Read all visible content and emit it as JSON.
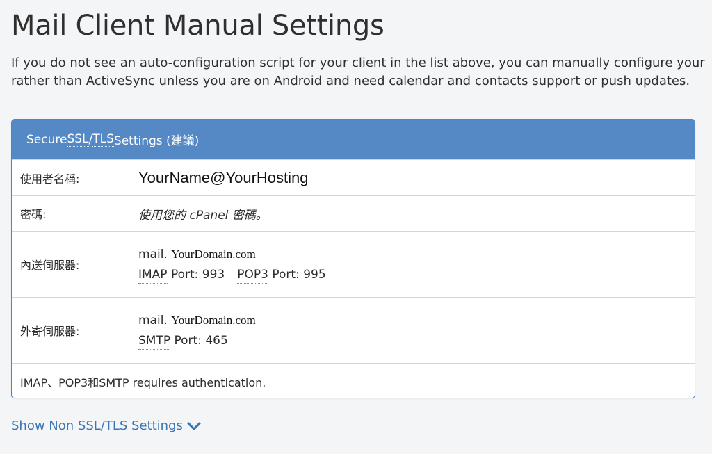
{
  "page": {
    "title": "Mail Client Manual Settings",
    "intro_line1": "If you do not see an auto-configuration script for your client in the list above, you can manually configure your",
    "intro_line2": "rather than ActiveSync unless you are on Android and need calendar and contacts support or push updates."
  },
  "panel": {
    "header_prefix": "Secure ",
    "header_ssl": "SSL",
    "header_slash": "/",
    "header_tls": "TLS",
    "header_suffix": " Settings (建議)",
    "username": {
      "label": "使用者名稱:",
      "value": "YourName@YourHosting"
    },
    "password": {
      "label": "密碼:",
      "value": "使用您的 cPanel 密碼。"
    },
    "incoming": {
      "label": "內送伺服器:",
      "host_prefix": "mail.",
      "host_domain": "YourDomain.com",
      "imap_label": "IMAP",
      "imap_port": " Port: 993",
      "pop3_label": "POP3",
      "pop3_port": " Port: 995"
    },
    "outgoing": {
      "label": "外寄伺服器:",
      "host_prefix": "mail.",
      "host_domain": "YourDomain.com",
      "smtp_label": "SMTP",
      "smtp_port": " Port: 465"
    },
    "note": "IMAP、POP3和SMTP requires authentication."
  },
  "toggle": {
    "label": "Show Non SSL/TLS Settings",
    "icon": "chevron-down-icon"
  },
  "colors": {
    "accent": "#5589c6",
    "link": "#3a76b5",
    "background": "#f4f5f7"
  }
}
